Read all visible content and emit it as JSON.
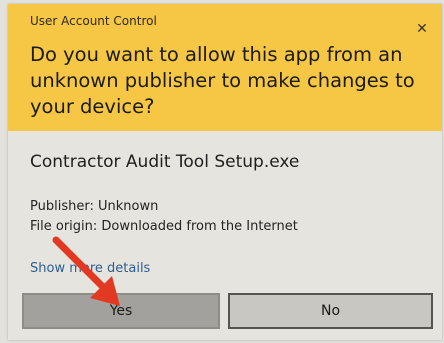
{
  "dialog": {
    "window_title": "User Account Control",
    "question": "Do you want to allow this app from an unknown publisher to make changes to your device?",
    "app_name": "Contractor Audit Tool Setup.exe",
    "publisher": "Publisher: Unknown",
    "file_origin": "File origin: Downloaded from the Internet",
    "details_link": "Show more details",
    "buttons": {
      "yes": "Yes",
      "no": "No"
    },
    "close_icon": "close-icon",
    "colors": {
      "header": "#f5c745",
      "link": "#2e5e8f",
      "annotation_arrow": "#e23a22"
    }
  }
}
